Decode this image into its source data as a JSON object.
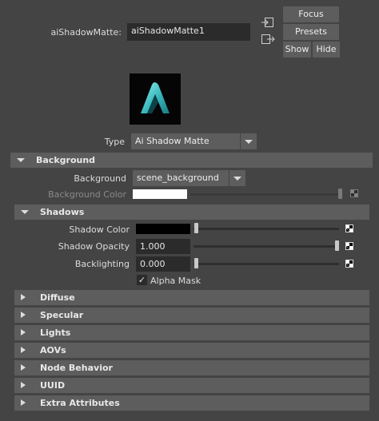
{
  "node": {
    "label": "aiShadowMatte:",
    "name": "aiShadowMatte1"
  },
  "buttons": {
    "focus": "Focus",
    "presets": "Presets",
    "show": "Show",
    "hide": "Hide"
  },
  "type_row": {
    "label": "Type",
    "value": "Ai Shadow Matte"
  },
  "background_section": {
    "title": "Background",
    "background_label": "Background",
    "background_value": "scene_background",
    "background_color_label": "Background Color",
    "background_color_value": "#ffffff",
    "background_color_slider": 1.0
  },
  "shadows_section": {
    "title": "Shadows",
    "shadow_color_label": "Shadow Color",
    "shadow_color_value": "#000000",
    "shadow_color_slider": 0.0,
    "shadow_opacity_label": "Shadow Opacity",
    "shadow_opacity_value": "1.000",
    "shadow_opacity_slider": 1.0,
    "backlighting_label": "Backlighting",
    "backlighting_value": "0.000",
    "backlighting_slider": 0.0,
    "alpha_mask_label": "Alpha Mask",
    "alpha_mask_checked": true
  },
  "collapsed_sections": [
    "Diffuse",
    "Specular",
    "Lights",
    "AOVs",
    "Node Behavior",
    "UUID",
    "Extra Attributes"
  ],
  "colors": {
    "panel_bg": "#444444",
    "section_header": "#5d5d5d",
    "field_bg": "#2b2b2b",
    "logo_teal": "#3ec6c8"
  },
  "icons": {
    "input_connection": "input-arrow-icon",
    "output_connection": "output-arrow-icon",
    "node_swatch": "arnold-logo-icon",
    "map_button": "checker-map-icon"
  }
}
